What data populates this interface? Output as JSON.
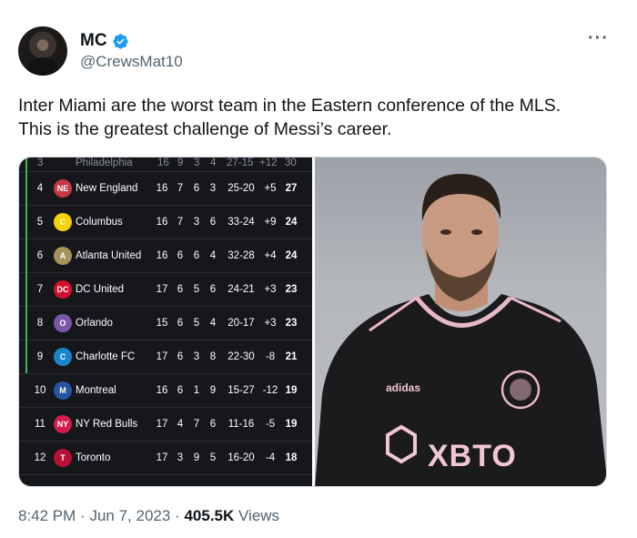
{
  "author": {
    "display_name": "MC",
    "handle": "@CrewsMat10",
    "verified_icon": "verified-badge-icon"
  },
  "tweet": {
    "text_line1": "Inter Miami are the worst team in the Eastern conference of the MLS.",
    "text_line2": "This is the greatest challenge of Messi’s career."
  },
  "standings": {
    "partial_top_row": {
      "rank": "3",
      "team": "Philadelphia",
      "gp": "16",
      "w": "9",
      "l": "3",
      "t": "4",
      "score": "27-15",
      "gd": "+12",
      "pts": "30"
    },
    "rows": [
      {
        "rank": "4",
        "team": "New England",
        "gp": "16",
        "w": "7",
        "l": "6",
        "t": "3",
        "score": "25-20",
        "gd": "+5",
        "pts": "27",
        "logo_color": "#c63845",
        "logo_text": "NE"
      },
      {
        "rank": "5",
        "team": "Columbus",
        "gp": "16",
        "w": "7",
        "l": "3",
        "t": "6",
        "score": "33-24",
        "gd": "+9",
        "pts": "24",
        "logo_color": "#f5d200",
        "logo_text": "C"
      },
      {
        "rank": "6",
        "team": "Atlanta United",
        "gp": "16",
        "w": "6",
        "l": "6",
        "t": "4",
        "score": "32-28",
        "gd": "+4",
        "pts": "24",
        "logo_color": "#a7925c",
        "logo_text": "A"
      },
      {
        "rank": "7",
        "team": "DC United",
        "gp": "17",
        "w": "6",
        "l": "5",
        "t": "6",
        "score": "24-21",
        "gd": "+3",
        "pts": "23",
        "logo_color": "#d2102e",
        "logo_text": "DC"
      },
      {
        "rank": "8",
        "team": "Orlando",
        "gp": "15",
        "w": "6",
        "l": "5",
        "t": "4",
        "score": "20-17",
        "gd": "+3",
        "pts": "23",
        "logo_color": "#7b57a6",
        "logo_text": "O"
      },
      {
        "rank": "9",
        "team": "Charlotte FC",
        "gp": "17",
        "w": "6",
        "l": "3",
        "t": "8",
        "score": "22-30",
        "gd": "-8",
        "pts": "21",
        "logo_color": "#1a85c8",
        "logo_text": "C"
      },
      {
        "rank": "10",
        "team": "Montreal",
        "gp": "16",
        "w": "6",
        "l": "1",
        "t": "9",
        "score": "15-27",
        "gd": "-12",
        "pts": "19",
        "logo_color": "#2654a4",
        "logo_text": "M"
      },
      {
        "rank": "11",
        "team": "NY Red Bulls",
        "gp": "17",
        "w": "4",
        "l": "7",
        "t": "6",
        "score": "11-16",
        "gd": "-5",
        "pts": "19",
        "logo_color": "#d21c4b",
        "logo_text": "NY"
      },
      {
        "rank": "12",
        "team": "Toronto",
        "gp": "17",
        "w": "3",
        "l": "9",
        "t": "5",
        "score": "16-20",
        "gd": "-4",
        "pts": "18",
        "logo_color": "#b81137",
        "logo_text": "T"
      }
    ]
  },
  "photo": {
    "sponsor_text": "XBTO",
    "brand_text": "adidas"
  },
  "meta": {
    "time": "8:42 PM",
    "sep1": "·",
    "date": "Jun 7, 2023",
    "sep2": "·",
    "views_count": "405.5K",
    "views_label": "Views"
  },
  "colors": {
    "accent_blue": "#1d9bf0",
    "playoff_green": "#3fb35a",
    "muted_text": "#536471"
  }
}
